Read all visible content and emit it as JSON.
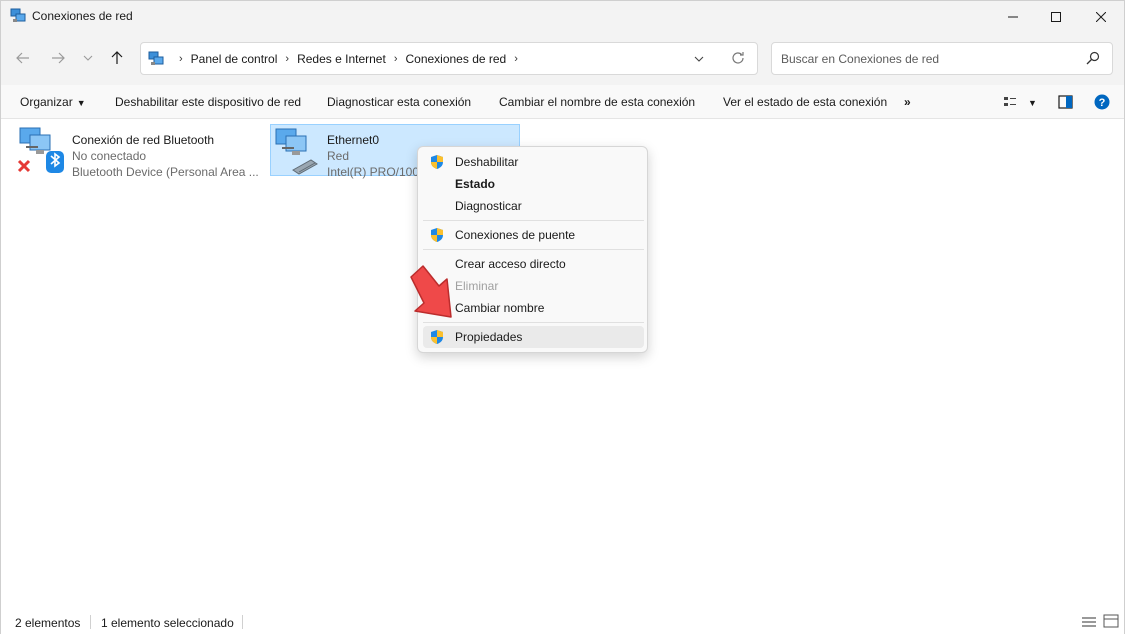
{
  "window": {
    "title": "Conexiones de red"
  },
  "nav": {
    "breadcrumb": [
      "Panel de control",
      "Redes e Internet",
      "Conexiones de red"
    ],
    "search_placeholder": "Buscar en Conexiones de red"
  },
  "toolbar": {
    "organize": "Organizar",
    "disable": "Deshabilitar este dispositivo de red",
    "diagnose": "Diagnosticar esta conexión",
    "rename": "Cambiar el nombre de esta conexión",
    "status": "Ver el estado de esta conexión",
    "more": "»"
  },
  "connections": [
    {
      "name": "Conexión de red Bluetooth",
      "status": "No conectado",
      "device": "Bluetooth Device (Personal Area ..."
    },
    {
      "name": "Ethernet0",
      "status": "Red",
      "device": "Intel(R) PRO/1000"
    }
  ],
  "context_menu": {
    "items": [
      {
        "label": "Deshabilitar",
        "shield": true
      },
      {
        "label": "Estado",
        "bold": true
      },
      {
        "label": "Diagnosticar"
      },
      {
        "label": "Conexiones de puente",
        "shield": true
      },
      {
        "label": "Crear acceso directo"
      },
      {
        "label": "Eliminar",
        "disabled": true
      },
      {
        "label": "Cambiar nombre"
      },
      {
        "label": "Propiedades",
        "shield": true
      }
    ]
  },
  "statusbar": {
    "count": "2 elementos",
    "selected": "1 elemento seleccionado"
  },
  "colors": {
    "accent": "#0067c0",
    "selection_bg": "#cce8ff",
    "arrow_red": "#e53935"
  }
}
